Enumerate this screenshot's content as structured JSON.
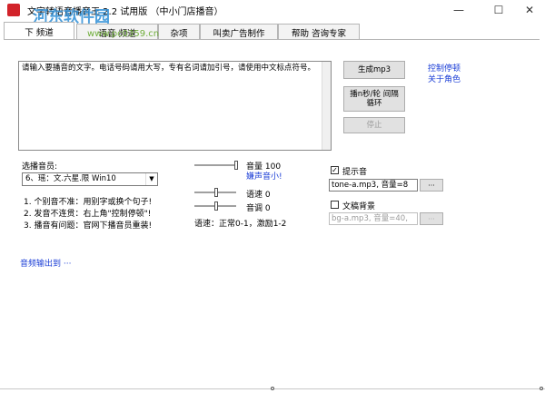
{
  "window": {
    "title": "文字转语音播音王 2.2 试用版 （中小门店播音）",
    "watermark": "河东软件园",
    "watermark_url": "www.pc0359.cn",
    "controls": {
      "minimize": "—",
      "maximize": "☐",
      "close": "✕"
    }
  },
  "tabs": [
    {
      "label": "下 频道"
    },
    {
      "label": "语音 频道"
    },
    {
      "label": "杂项"
    },
    {
      "label": "叫卖广告制作"
    },
    {
      "label": "帮助 咨询专家"
    }
  ],
  "editor": {
    "text": "请输入要播音的文字。电话号码请用大写，专有名词请加引号，请使用中文标点符号。"
  },
  "buttons": {
    "generate_mp3": "生成mp3",
    "play_loop": "播n秒/轮 间隔循环",
    "stop": "停止"
  },
  "links": {
    "control_stop": "控制停顿",
    "about_role": "关于角色",
    "output_audio": "音频输出到 ···"
  },
  "voice": {
    "label": "选播音员:",
    "selected": "6、瑶：文.六星.限 Win10",
    "tips": [
      "1. 个别音不准：用别字或换个句子!",
      "2. 发音不连贯：右上角\"控制停顿\"!",
      "3. 播音有问题：官网下播音员重装!"
    ]
  },
  "sliders": {
    "volume_label": "音量 100",
    "volume_value": 100,
    "volume_hint": "嫌声音小!",
    "speed_label": "语速 0",
    "speed_value": 0,
    "pitch_label": "音调 0",
    "pitch_value": 0,
    "speed_note": "语速：正常0-1，激励1-2"
  },
  "prompt_sound": {
    "label": "提示音",
    "checked": true,
    "value": "tone-a.mp3, 音量=8",
    "browse": "···"
  },
  "background": {
    "label": "文稿背景",
    "checked": false,
    "value": "bg-a.mp3, 音量=40,",
    "browse": "···"
  },
  "colors": {
    "link": "#1a3dd6",
    "watermark": "#2f8fd6",
    "app_icon": "#d2232a"
  }
}
